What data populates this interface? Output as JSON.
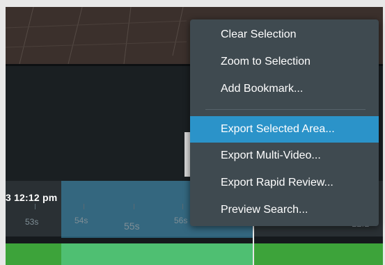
{
  "timeline": {
    "timestamp": "3 12:12 pm",
    "ticks": [
      "53s",
      "54s",
      "55s",
      "56s"
    ],
    "right_time": "12:1"
  },
  "context_menu": {
    "items": [
      {
        "label": "Clear Selection"
      },
      {
        "label": "Zoom to Selection"
      },
      {
        "label": "Add Bookmark..."
      },
      {
        "label": "Export Selected Area...",
        "highlighted": true
      },
      {
        "label": "Export Multi-Video..."
      },
      {
        "label": "Export Rapid Review..."
      },
      {
        "label": "Preview Search..."
      }
    ]
  },
  "colors": {
    "menu_bg": "#3f4a50",
    "menu_highlight": "#2b93c9",
    "selection": "#3c96be",
    "recording_bar": "#3da33a"
  }
}
